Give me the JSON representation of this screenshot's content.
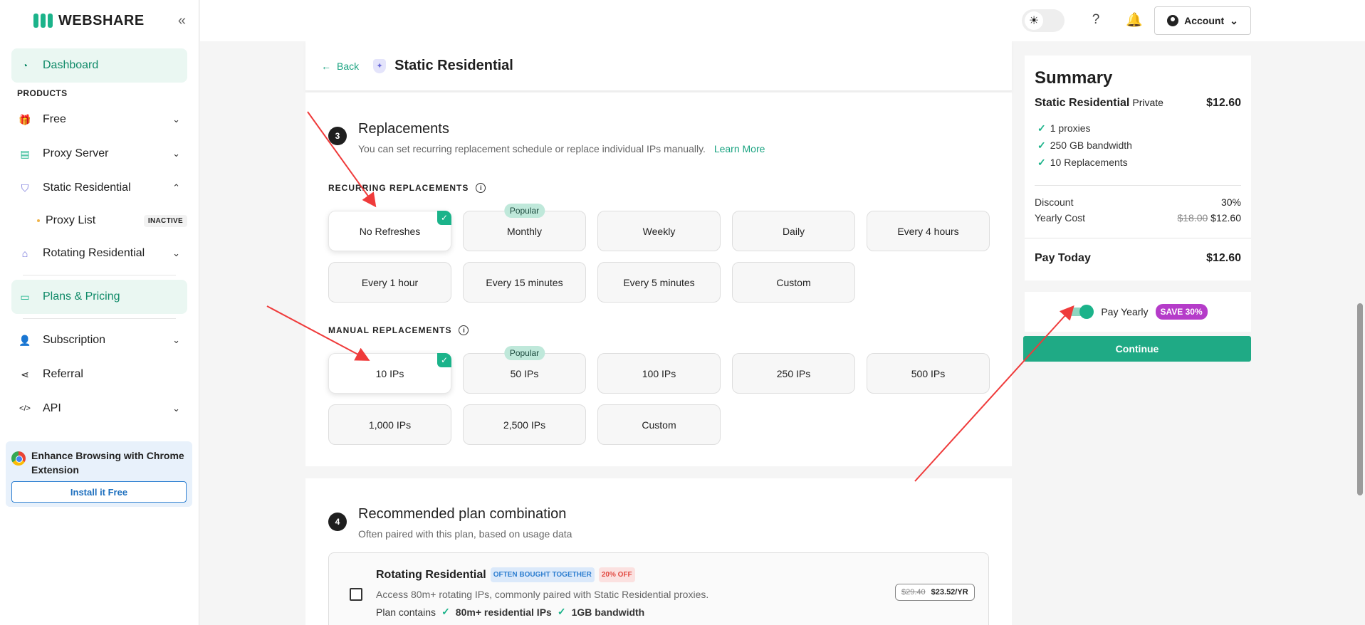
{
  "brand": {
    "name": "WEBSHARE",
    "collapse_icon": "double-chevron-left-icon",
    "accent": "#1bb38a"
  },
  "sidebar": {
    "dashboard": "Dashboard",
    "products_label": "PRODUCTS",
    "free": "Free",
    "proxy_server": "Proxy Server",
    "static_residential": "Static Residential",
    "proxy_list": "Proxy List",
    "proxy_list_badge": "INACTIVE",
    "rotating_residential": "Rotating Residential",
    "plans_pricing": "Plans & Pricing",
    "subscription": "Subscription",
    "referral": "Referral",
    "api": "API",
    "chrome_card": {
      "text": "Enhance Browsing with Chrome Extension",
      "button": "Install it Free"
    }
  },
  "topbar": {
    "account": "Account",
    "icons": [
      "sun-icon",
      "help-icon",
      "bell-icon",
      "user-icon"
    ]
  },
  "header": {
    "back": "Back",
    "title": "Static Residential"
  },
  "replacements": {
    "step": "3",
    "title": "Replacements",
    "subtitle": "You can set recurring replacement schedule or replace individual IPs manually.",
    "learn_more": "Learn More",
    "recurring_label": "RECURRING REPLACEMENTS",
    "recurring_options": [
      "No Refreshes",
      "Monthly",
      "Weekly",
      "Daily",
      "Every 4 hours",
      "Every 1 hour",
      "Every 15 minutes",
      "Every 5 minutes",
      "Custom"
    ],
    "manual_label": "MANUAL REPLACEMENTS",
    "manual_options": [
      "10 IPs",
      "50 IPs",
      "100 IPs",
      "250 IPs",
      "500 IPs",
      "1,000 IPs",
      "2,500 IPs",
      "Custom"
    ],
    "popular": "Popular",
    "selected_recurring": "No Refreshes",
    "selected_manual": "10 IPs"
  },
  "recommended": {
    "step": "4",
    "title": "Recommended plan combination",
    "subtitle": "Often paired with this plan, based on usage data",
    "item": {
      "name": "Rotating Residential",
      "tag1": "OFTEN BOUGHT TOGETHER",
      "tag2": "20% OFF",
      "desc": "Access 80m+ rotating IPs, commonly paired with Static Residential proxies.",
      "contains_label": "Plan contains",
      "feature1": "80m+ residential IPs",
      "feature2": "1GB bandwidth",
      "old_price": "$29.40",
      "price": "$23.52/YR"
    }
  },
  "summary": {
    "title": "Summary",
    "plan": "Static Residential",
    "plan_type": "Private",
    "plan_price": "$12.60",
    "features": [
      "1 proxies",
      "250 GB bandwidth",
      "10 Replacements"
    ],
    "discount_label": "Discount",
    "discount_value": "30%",
    "yearly_label": "Yearly Cost",
    "yearly_old": "$18.00",
    "yearly_new": "$12.60",
    "pay_today_label": "Pay Today",
    "pay_today_value": "$12.60"
  },
  "billing": {
    "pay_yearly": "Pay Yearly",
    "save_badge": "SAVE 30%",
    "pay_yearly_on": true,
    "continue": "Continue"
  }
}
